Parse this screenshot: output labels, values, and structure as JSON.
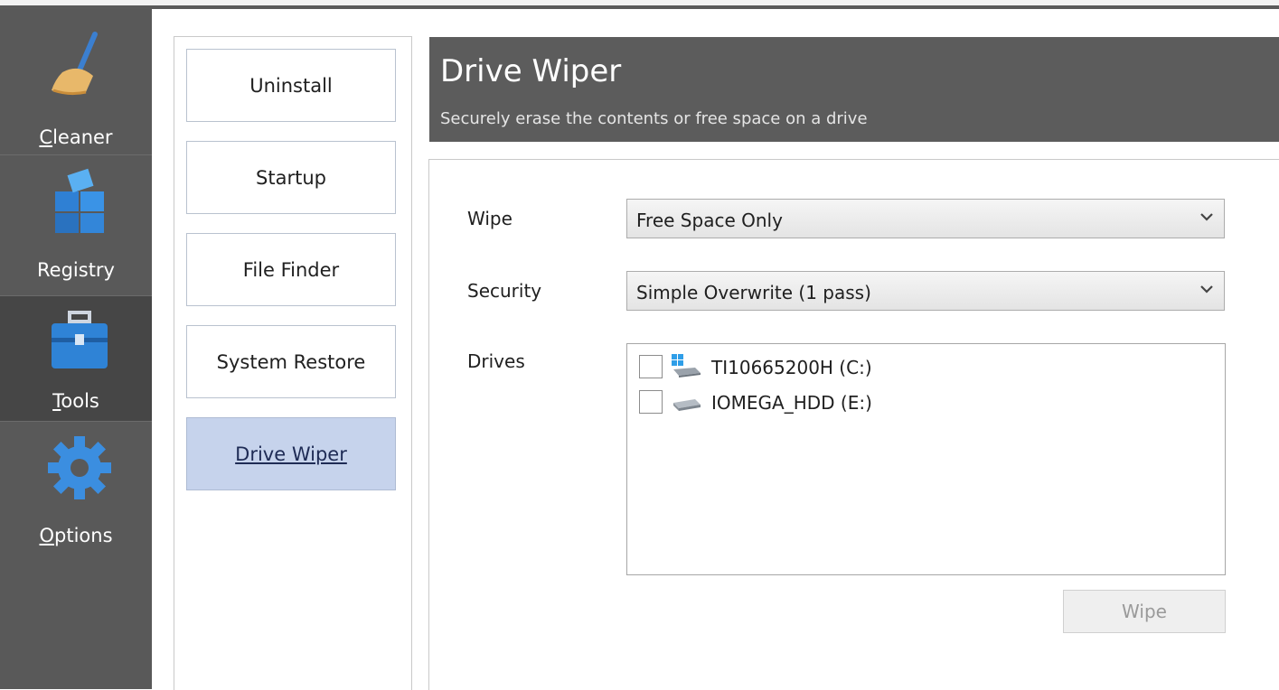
{
  "left_nav": {
    "items": [
      {
        "label": "Cleaner",
        "accel": "C",
        "rest": "leaner",
        "icon": "broom-icon"
      },
      {
        "label": "Registry",
        "icon": "registry-cubes-icon"
      },
      {
        "label": "Tools",
        "accel": "T",
        "rest": "ools",
        "icon": "toolbox-icon"
      },
      {
        "label": "Options",
        "accel": "O",
        "rest": "ptions",
        "icon": "gear-icon"
      }
    ],
    "active": "Tools"
  },
  "sub_nav": {
    "items": [
      "Uninstall",
      "Startup",
      "File Finder",
      "System Restore",
      "Drive Wiper"
    ],
    "active": "Drive Wiper"
  },
  "header": {
    "title": "Drive Wiper",
    "subtitle": "Securely erase the contents or free space on a drive"
  },
  "form": {
    "wipe_label": "Wipe",
    "wipe_value": "Free Space Only",
    "security_label": "Security",
    "security_value": "Simple Overwrite (1 pass)",
    "drives_label": "Drives",
    "drives": [
      {
        "name": "TI10665200H (C:)",
        "checked": false,
        "icon": "windows-drive-icon"
      },
      {
        "name": "IOMEGA_HDD (E:)",
        "checked": false,
        "icon": "hard-drive-icon"
      }
    ],
    "wipe_button": "Wipe"
  },
  "colors": {
    "nav_bg": "#595959",
    "nav_active": "#464646",
    "header_bg": "#5c5c5c",
    "subnav_active": "#c6d3ec"
  }
}
